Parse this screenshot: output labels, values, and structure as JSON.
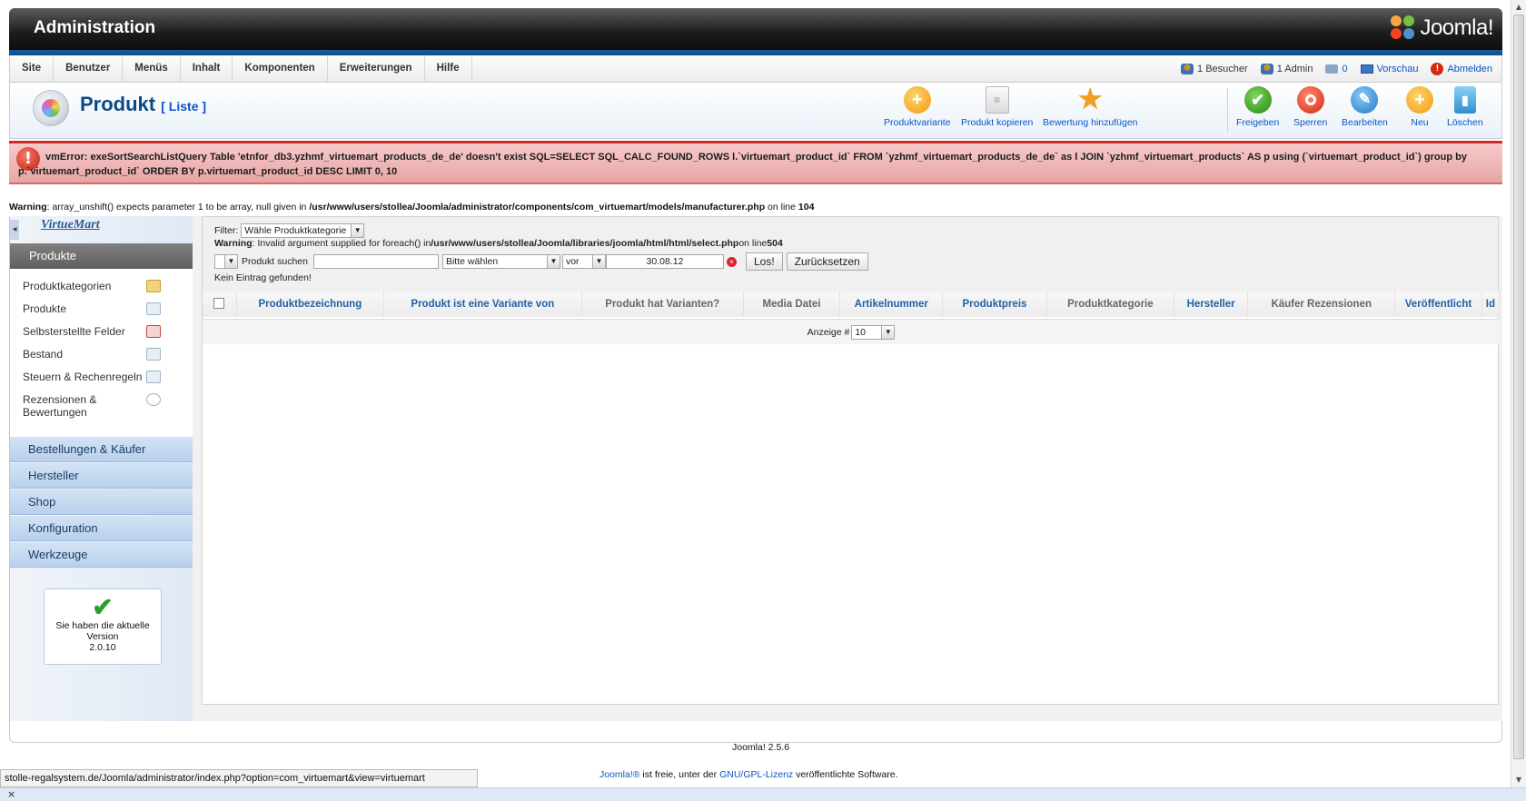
{
  "header": {
    "title": "Administration",
    "logo_text": "Joomla!"
  },
  "menu": {
    "items": [
      "Site",
      "Benutzer",
      "Menüs",
      "Inhalt",
      "Komponenten",
      "Erweiterungen",
      "Hilfe"
    ],
    "status": {
      "visitors": "1 Besucher",
      "admins": "1 Admin",
      "messages": "0",
      "preview": "Vorschau",
      "logout": "Abmelden"
    }
  },
  "toolbar": {
    "page_title": "Produkt",
    "page_subtitle": "[ Liste ]",
    "buttons": [
      {
        "label": "Produktvariante",
        "icon": "add-icon",
        "color": "#f7a51b"
      },
      {
        "label": "Produkt kopieren",
        "icon": "copy-icon",
        "color": "#d9d9d9"
      },
      {
        "label": "Bewertung hinzufügen",
        "icon": "star-icon",
        "color": "#f0a020"
      },
      {
        "label": "Freigeben",
        "icon": "check-icon",
        "color": "#2e9a1e"
      },
      {
        "label": "Sperren",
        "icon": "block-icon",
        "color": "#d9331f"
      },
      {
        "label": "Bearbeiten",
        "icon": "pencil-icon",
        "color": "#2e8fd6"
      },
      {
        "label": "Neu",
        "icon": "add-icon",
        "color": "#f7a51b"
      },
      {
        "label": "Löschen",
        "icon": "trash-icon",
        "color": "#3aa0e0"
      }
    ]
  },
  "error": {
    "message": "vmError: exeSortSearchListQuery Table 'etnfor_db3.yzhmf_virtuemart_products_de_de' doesn't exist SQL=SELECT SQL_CALC_FOUND_ROWS l.`virtuemart_product_id` FROM `yzhmf_virtuemart_products_de_de` as l JOIN `yzhmf_virtuemart_products` AS p using (`virtuemart_product_id`) group by p.`virtuemart_product_id` ORDER BY p.virtuemart_product_id DESC LIMIT 0, 10"
  },
  "warning1": {
    "label": "Warning",
    "text": ": array_unshift() expects parameter 1 to be array, null given in ",
    "path": "/usr/www/users/stollea/Joomla/administrator/components/com_virtuemart/models/manufacturer.php",
    "online": " on line ",
    "line": "104"
  },
  "sidebar": {
    "logo": "VirtueMart",
    "active_section": "Produkte",
    "items": [
      {
        "label": "Produktkategorien",
        "icon": "folder-icon"
      },
      {
        "label": "Produkte",
        "icon": "camera-icon"
      },
      {
        "label": "Selbsterstellte Felder",
        "icon": "doc-icon"
      },
      {
        "label": "Bestand",
        "icon": "chart-icon"
      },
      {
        "label": "Steuern & Rechenregeln",
        "icon": "calculator-icon"
      },
      {
        "label": "Rezensionen & Bewertungen",
        "icon": "comment-icon"
      }
    ],
    "sections": [
      "Bestellungen & Käufer",
      "Hersteller",
      "Shop",
      "Konfiguration",
      "Werkzeuge"
    ],
    "version_box": {
      "text": "Sie haben die aktuelle Version",
      "version": "2.0.10"
    }
  },
  "filters": {
    "filter_label": "Filter:",
    "category_select": "Wähle Produktkategorie",
    "warning2": {
      "label": "Warning",
      "text": ": Invalid argument supplied for foreach() in ",
      "path": "/usr/www/users/stollea/Joomla/libraries/joomla/html/html/select.php",
      "online": " on line ",
      "line": "504"
    },
    "search_label": "Produkt suchen",
    "search_value": "",
    "type_select": "Bitte wählen",
    "period_select": "vor",
    "date_value": "30.08.12",
    "go_button": "Los!",
    "reset_button": "Zurücksetzen",
    "empty_text": "Kein Eintrag gefunden!"
  },
  "table": {
    "columns": [
      {
        "label": "Produktbezeichnung",
        "link": true
      },
      {
        "label": "Produkt ist eine Variante von",
        "link": true
      },
      {
        "label": "Produkt hat Varianten?",
        "link": false
      },
      {
        "label": "Media Datei",
        "link": false
      },
      {
        "label": "Artikelnummer",
        "link": true
      },
      {
        "label": "Produktpreis",
        "link": true
      },
      {
        "label": "Produktkategorie",
        "link": false
      },
      {
        "label": "Hersteller",
        "link": true
      },
      {
        "label": "Käufer Rezensionen",
        "link": false
      },
      {
        "label": "Veröffentlicht",
        "link": true
      },
      {
        "label": "Id",
        "link": true
      }
    ],
    "pagination_label": "Anzeige #",
    "pagination_value": "10"
  },
  "footer": {
    "version": "Joomla! 2.5.6",
    "license_prefix": "Joomla!®",
    "license_mid": " ist freie, unter der ",
    "license_link": "GNU/GPL-Lizenz",
    "license_suffix": " veröffentlichte Software."
  },
  "browser": {
    "status_url": "stolle-regalsystem.de/Joomla/administrator/index.php?option=com_virtuemart&view=virtuemart",
    "close": "×"
  }
}
